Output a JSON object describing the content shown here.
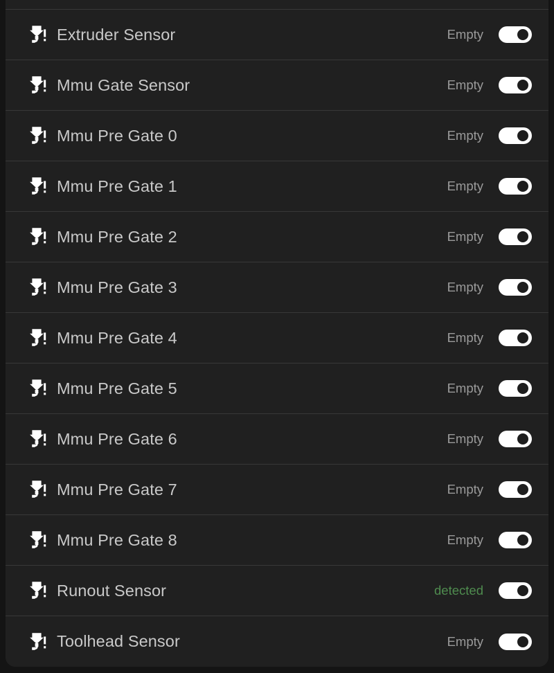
{
  "theme": {
    "page_background": "#141414",
    "row_background": "#202020",
    "divider": "#383838",
    "label_color": "#c9c9c9",
    "status_empty_color": "#9b9b9b",
    "status_detected_color": "#4f8c4f",
    "toggle_track_on": "#ffffff",
    "toggle_knob_on": "#1d1d1d"
  },
  "panel": {
    "name": "filament-sensors-list",
    "icon": "filament-sensor-icon"
  },
  "sensors": [
    {
      "label": "Extruder Sensor",
      "status": "Empty",
      "state": "empty",
      "toggle": "on"
    },
    {
      "label": "Mmu Gate Sensor",
      "status": "Empty",
      "state": "empty",
      "toggle": "on"
    },
    {
      "label": "Mmu Pre Gate 0",
      "status": "Empty",
      "state": "empty",
      "toggle": "on"
    },
    {
      "label": "Mmu Pre Gate 1",
      "status": "Empty",
      "state": "empty",
      "toggle": "on"
    },
    {
      "label": "Mmu Pre Gate 2",
      "status": "Empty",
      "state": "empty",
      "toggle": "on"
    },
    {
      "label": "Mmu Pre Gate 3",
      "status": "Empty",
      "state": "empty",
      "toggle": "on"
    },
    {
      "label": "Mmu Pre Gate 4",
      "status": "Empty",
      "state": "empty",
      "toggle": "on"
    },
    {
      "label": "Mmu Pre Gate 5",
      "status": "Empty",
      "state": "empty",
      "toggle": "on"
    },
    {
      "label": "Mmu Pre Gate 6",
      "status": "Empty",
      "state": "empty",
      "toggle": "on"
    },
    {
      "label": "Mmu Pre Gate 7",
      "status": "Empty",
      "state": "empty",
      "toggle": "on"
    },
    {
      "label": "Mmu Pre Gate 8",
      "status": "Empty",
      "state": "empty",
      "toggle": "on"
    },
    {
      "label": "Runout Sensor",
      "status": "detected",
      "state": "detected",
      "toggle": "on"
    },
    {
      "label": "Toolhead Sensor",
      "status": "Empty",
      "state": "empty",
      "toggle": "on"
    }
  ]
}
